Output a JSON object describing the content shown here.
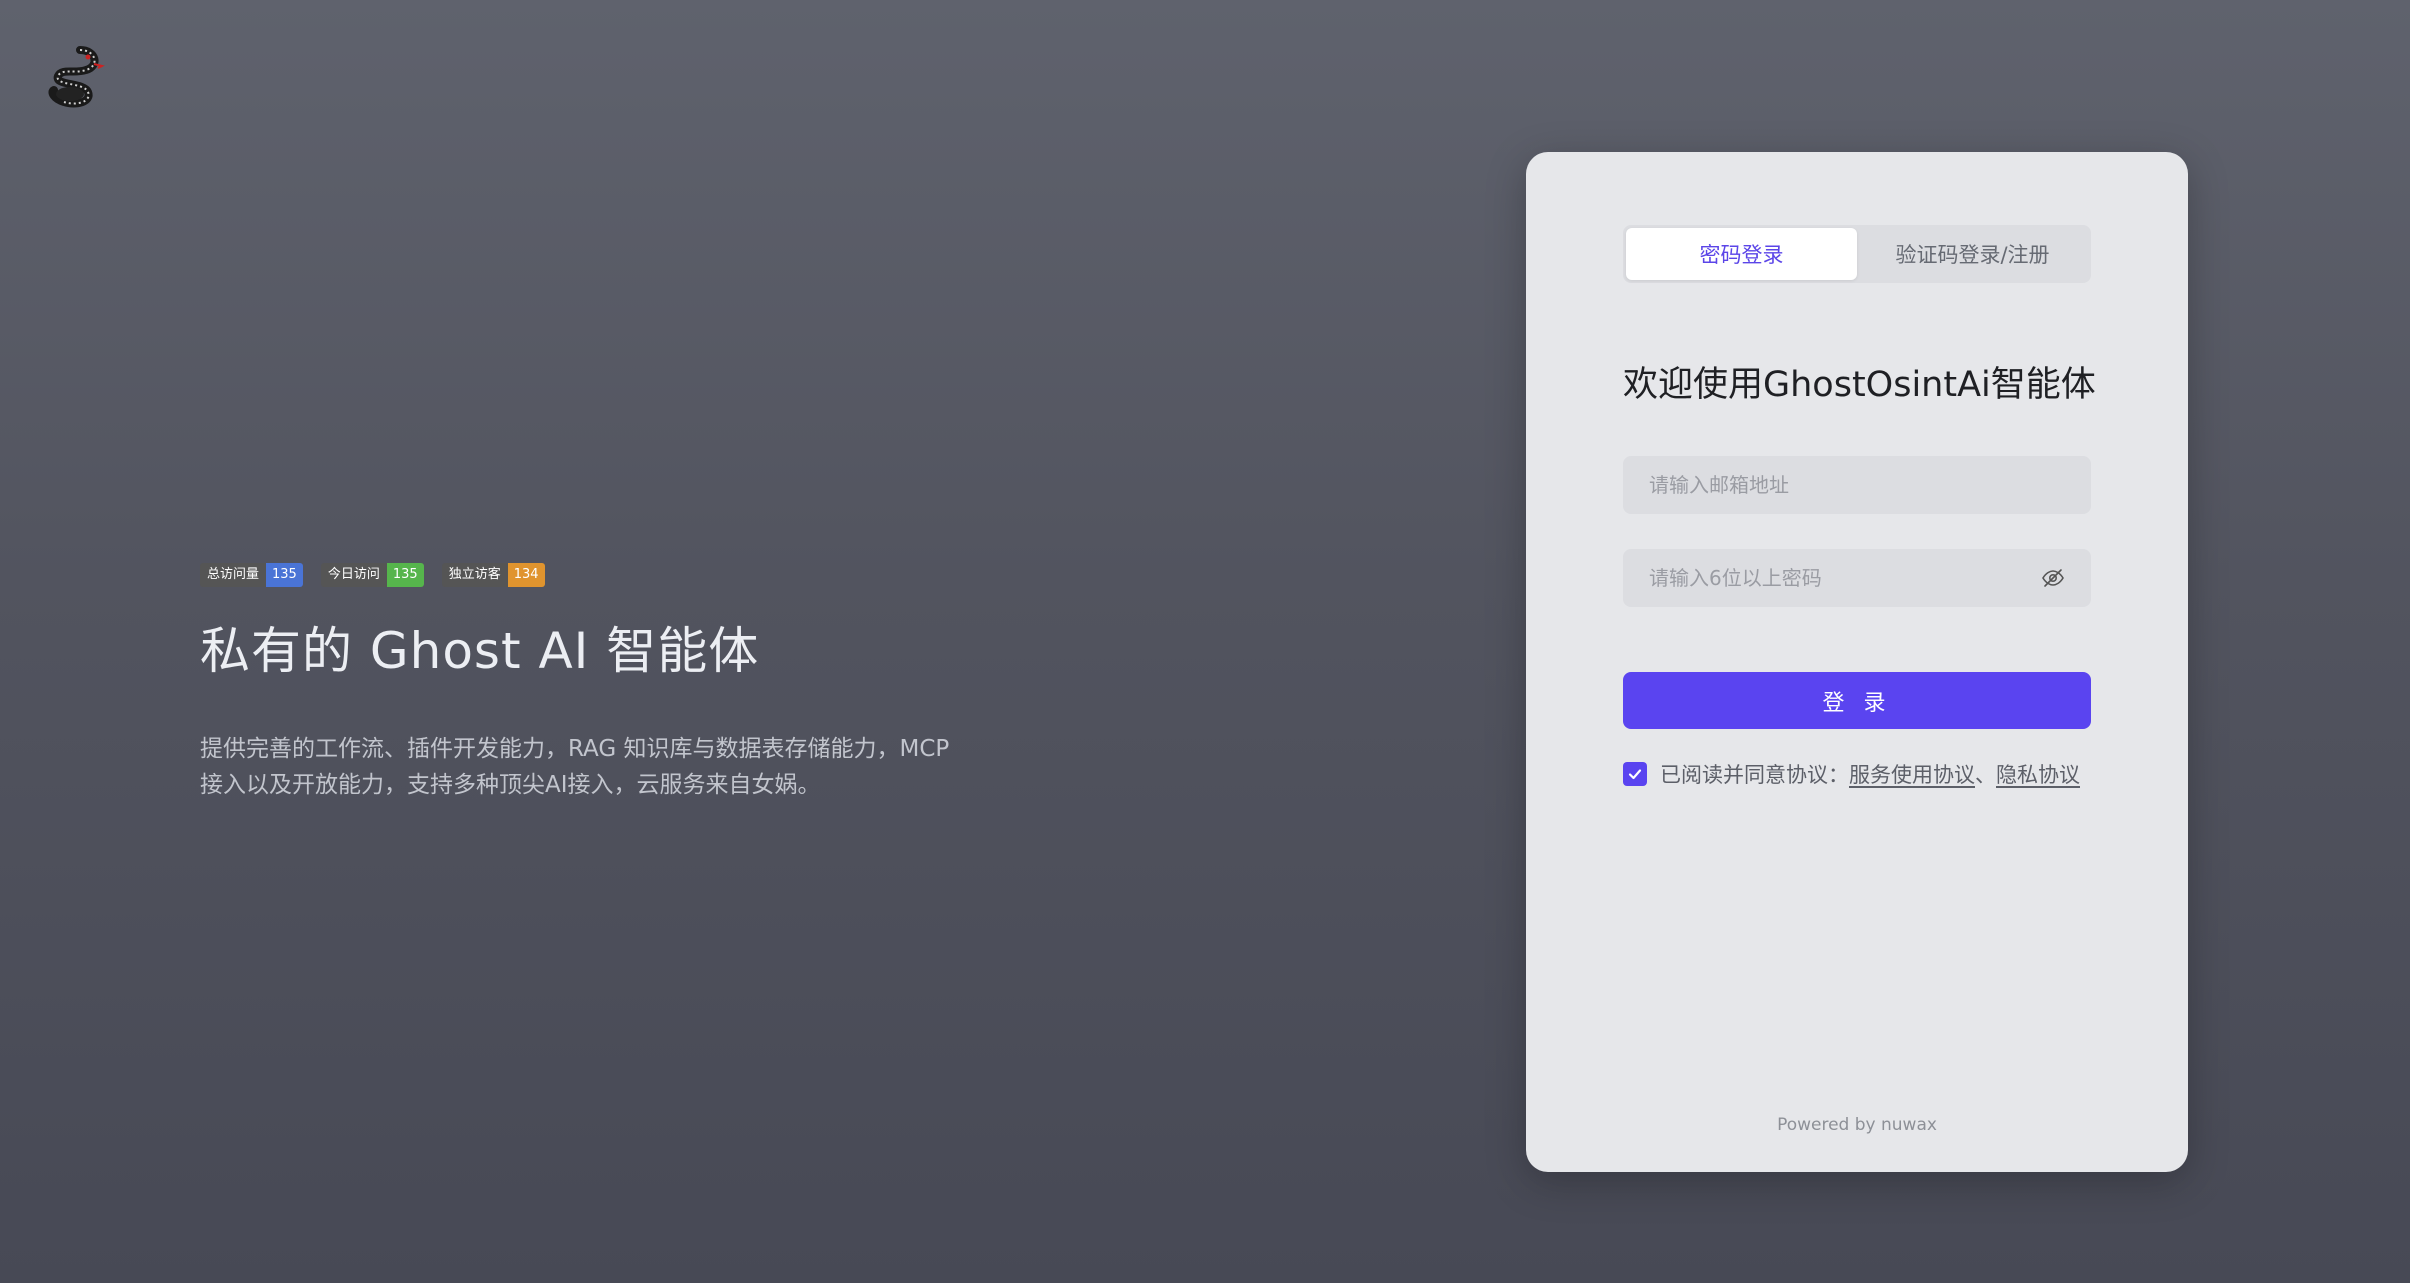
{
  "brand": {
    "logo_icon": "snake-logo-icon"
  },
  "stats": [
    {
      "label": "总访问量",
      "count": "135",
      "color": "#4a74d6"
    },
    {
      "label": "今日访问",
      "count": "135",
      "color": "#56b54c"
    },
    {
      "label": "独立访客",
      "count": "134",
      "color": "#e0942e"
    }
  ],
  "hero": {
    "title": "私有的 Ghost AI 智能体",
    "description": "提供完善的工作流、插件开发能力，RAG 知识库与数据表存储能力，MCP接入以及开放能力，支持多种顶尖AI接入，云服务来自女娲。"
  },
  "login": {
    "tabs": [
      {
        "label": "密码登录",
        "active": true
      },
      {
        "label": "验证码登录/注册",
        "active": false
      }
    ],
    "welcome": "欢迎使用GhostOsintAi智能体",
    "email_placeholder": "请输入邮箱地址",
    "password_placeholder": "请输入6位以上密码",
    "submit_label": "登 录",
    "agree_prefix": "已阅读并同意协议：",
    "terms_link": "服务使用协议",
    "separator": "、",
    "privacy_link": "隐私协议",
    "footer": "Powered by nuwax"
  },
  "colors": {
    "accent": "#5a44f0",
    "card_bg": "#e6e7ea"
  }
}
